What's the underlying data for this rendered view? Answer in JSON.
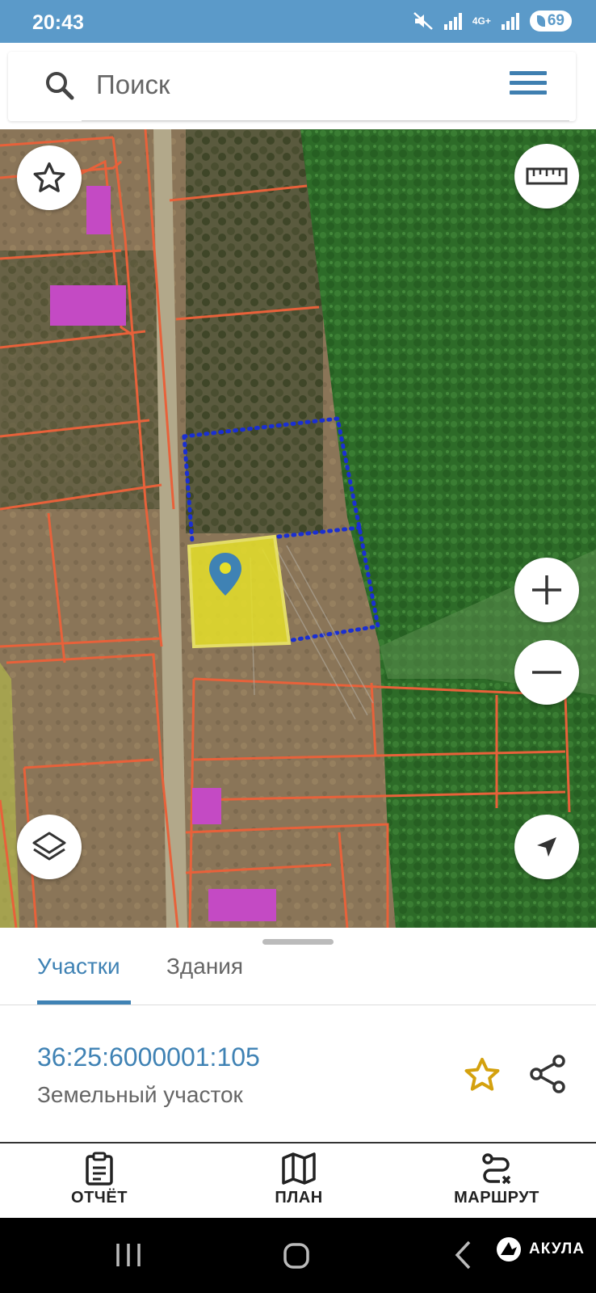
{
  "status_bar": {
    "time": "20:43",
    "network": "4G+",
    "battery": "69"
  },
  "search": {
    "placeholder": "Поиск"
  },
  "map": {
    "buttons": [
      "favorites-icon",
      "ruler-icon",
      "zoom-in-icon",
      "zoom-out-icon",
      "layers-icon",
      "my-location-icon"
    ],
    "colors": {
      "forest": "#2f6f2a",
      "parcel_border": "#e8613a",
      "building": "#c44ac4",
      "selected_parcel": "#e6e02a",
      "dotted_outline": "#1a2fd1"
    }
  },
  "sheet": {
    "tabs": [
      {
        "label": "Участки",
        "active": true
      },
      {
        "label": "Здания",
        "active": false
      }
    ],
    "parcel": {
      "number": "36:25:6000001:105",
      "type": "Земельный участок"
    }
  },
  "bottom_nav": [
    {
      "label": "ОТЧЁТ",
      "icon": "clipboard-icon"
    },
    {
      "label": "ПЛАН",
      "icon": "map-icon"
    },
    {
      "label": "МАРШРУТ",
      "icon": "route-icon"
    }
  ],
  "watermark": "АКУЛА",
  "accent_color": "#3f82b4"
}
